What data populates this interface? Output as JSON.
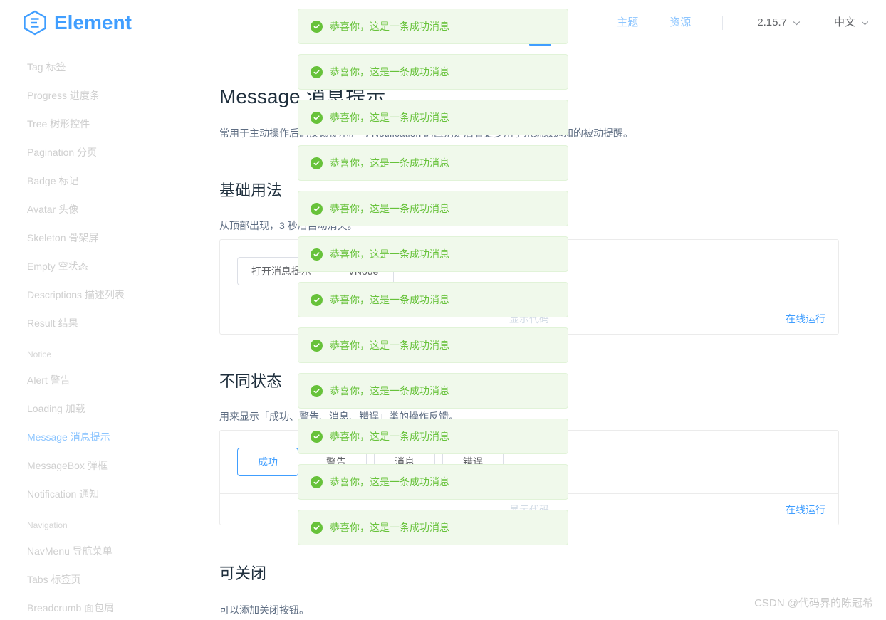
{
  "header": {
    "logo_text": "Element",
    "links": [
      {
        "label": "主题",
        "name": "nav-theme"
      },
      {
        "label": "资源",
        "name": "nav-resources"
      }
    ],
    "version": "2.15.7",
    "language": "中文"
  },
  "sidebar": {
    "items": [
      {
        "type": "item",
        "label": "Tag 标签",
        "key": "tag",
        "active": false
      },
      {
        "type": "item",
        "label": "Progress 进度条",
        "key": "progress",
        "active": false
      },
      {
        "type": "item",
        "label": "Tree 树形控件",
        "key": "tree",
        "active": false
      },
      {
        "type": "item",
        "label": "Pagination 分页",
        "key": "pagination",
        "active": false
      },
      {
        "type": "item",
        "label": "Badge 标记",
        "key": "badge",
        "active": false
      },
      {
        "type": "item",
        "label": "Avatar 头像",
        "key": "avatar",
        "active": false
      },
      {
        "type": "item",
        "label": "Skeleton 骨架屏",
        "key": "skeleton",
        "active": false
      },
      {
        "type": "item",
        "label": "Empty 空状态",
        "key": "empty",
        "active": false
      },
      {
        "type": "item",
        "label": "Descriptions 描述列表",
        "key": "descriptions",
        "active": false
      },
      {
        "type": "item",
        "label": "Result 结果",
        "key": "result",
        "active": false
      },
      {
        "type": "group",
        "label": "Notice",
        "key": "notice"
      },
      {
        "type": "item",
        "label": "Alert 警告",
        "key": "alert",
        "active": false
      },
      {
        "type": "item",
        "label": "Loading 加载",
        "key": "loading",
        "active": false
      },
      {
        "type": "item",
        "label": "Message 消息提示",
        "key": "message",
        "active": true
      },
      {
        "type": "item",
        "label": "MessageBox 弹框",
        "key": "messagebox",
        "active": false
      },
      {
        "type": "item",
        "label": "Notification 通知",
        "key": "notification",
        "active": false
      },
      {
        "type": "group",
        "label": "Navigation",
        "key": "navigation"
      },
      {
        "type": "item",
        "label": "NavMenu 导航菜单",
        "key": "navmenu",
        "active": false
      },
      {
        "type": "item",
        "label": "Tabs 标签页",
        "key": "tabs",
        "active": false
      },
      {
        "type": "item",
        "label": "Breadcrumb 面包屑",
        "key": "breadcrumb",
        "active": false
      }
    ]
  },
  "main": {
    "page_title": "Message 消息提示",
    "intro": "常用于主动操作后的反馈提示。与 Notification 的区别是后者更多用于系统级通知的被动提醒。",
    "sections": [
      {
        "key": "basic",
        "heading": "基础用法",
        "desc": "从顶部出现，3 秒后自动消失。",
        "buttons": [
          {
            "label": "打开消息提示",
            "variant": "default",
            "name": "open-message-button"
          },
          {
            "label": "VNode",
            "variant": "default",
            "name": "vnode-button"
          }
        ]
      },
      {
        "key": "types",
        "heading": "不同状态",
        "desc": "用来显示「成功、警告、消息、错误」类的操作反馈。",
        "buttons": [
          {
            "label": "成功",
            "variant": "primary-outline",
            "name": "success-button"
          },
          {
            "label": "警告",
            "variant": "default",
            "name": "warning-button"
          },
          {
            "label": "消息",
            "variant": "default",
            "name": "info-button"
          },
          {
            "label": "错误",
            "variant": "default",
            "name": "error-button"
          }
        ]
      },
      {
        "key": "closable",
        "heading": "可关闭",
        "desc": "可以添加关闭按钮。",
        "buttons": []
      }
    ],
    "demo_footer": {
      "show_code": "显示代码",
      "run_online": "在线运行"
    }
  },
  "toasts": {
    "message": "恭喜你，这是一条成功消息",
    "type": "success",
    "icon": "check-circle-icon",
    "count": 12,
    "tops": [
      12,
      76,
      140,
      204,
      268,
      332,
      396,
      460,
      524,
      588,
      652,
      716
    ],
    "colors": {
      "background": "#f0f9eb",
      "border": "#e1f3d8",
      "text": "#67c23a",
      "icon": "#67c23a"
    }
  },
  "watermark": "CSDN @代码界的陈冠希",
  "theme": {
    "accent": "#409eff",
    "success": "#67c23a",
    "heading": "#1f2f3d",
    "body_text": "#5e6d82"
  }
}
